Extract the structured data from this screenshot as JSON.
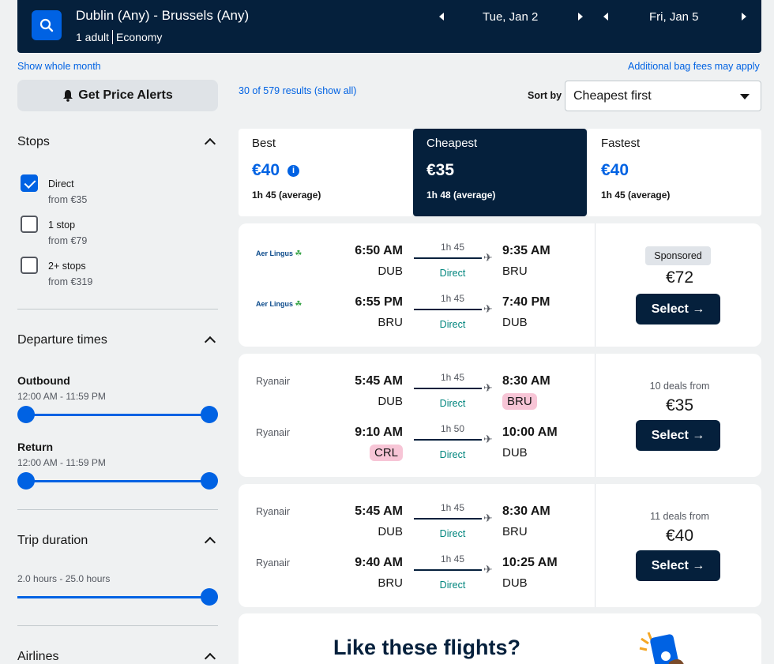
{
  "header": {
    "route": "Dublin (Any) - Brussels (Any)",
    "adults": "1 adult",
    "cabin": "Economy",
    "depart_date": "Tue, Jan 2",
    "return_date": "Fri, Jan 5"
  },
  "links": {
    "show_whole_month": "Show whole month",
    "bag_fees": "Additional bag fees may apply",
    "results": "30 of 579 results (show all)"
  },
  "alerts": {
    "label": "Get Price Alerts"
  },
  "sort": {
    "label": "Sort by",
    "value": "Cheapest first"
  },
  "filters": {
    "stops": {
      "title": "Stops",
      "options": [
        {
          "label": "Direct",
          "from": "from €35",
          "checked": true
        },
        {
          "label": "1 stop",
          "from": "from €79",
          "checked": false
        },
        {
          "label": "2+ stops",
          "from": "from €319",
          "checked": false
        }
      ]
    },
    "departure": {
      "title": "Departure times",
      "outbound_label": "Outbound",
      "outbound_range": "12:00 AM - 11:59 PM",
      "return_label": "Return",
      "return_range": "12:00 AM - 11:59 PM"
    },
    "duration": {
      "title": "Trip duration",
      "range": "2.0 hours - 25.0 hours"
    },
    "airlines": {
      "title": "Airlines"
    }
  },
  "tabs": [
    {
      "label": "Best",
      "price": "€40",
      "avg": "1h 45 (average)"
    },
    {
      "label": "Cheapest",
      "price": "€35",
      "avg": "1h 48 (average)"
    },
    {
      "label": "Fastest",
      "price": "€40",
      "avg": "1h 45 (average)"
    }
  ],
  "cards": [
    {
      "sponsored": "Sponsored",
      "price": "€72",
      "select": "Select →",
      "legs": [
        {
          "airline": "Aer Lingus",
          "dep": "6:50 AM",
          "dep_code": "DUB",
          "dur": "1h 45",
          "stops": "Direct",
          "arr": "9:35 AM",
          "arr_code": "BRU"
        },
        {
          "airline": "Aer Lingus",
          "dep": "6:55 PM",
          "dep_code": "BRU",
          "dur": "1h 45",
          "stops": "Direct",
          "arr": "7:40 PM",
          "arr_code": "DUB"
        }
      ]
    },
    {
      "deals": "10 deals from",
      "price": "€35",
      "select": "Select →",
      "legs": [
        {
          "airline": "Ryanair",
          "dep": "5:45 AM",
          "dep_code": "DUB",
          "dur": "1h 45",
          "stops": "Direct",
          "arr": "8:30 AM",
          "arr_code": "BRU"
        },
        {
          "airline": "Ryanair",
          "dep": "9:10 AM",
          "dep_code": "CRL",
          "dur": "1h 50",
          "stops": "Direct",
          "arr": "10:00 AM",
          "arr_code": "DUB"
        }
      ]
    },
    {
      "deals": "11 deals from",
      "price": "€40",
      "select": "Select →",
      "legs": [
        {
          "airline": "Ryanair",
          "dep": "5:45 AM",
          "dep_code": "DUB",
          "dur": "1h 45",
          "stops": "Direct",
          "arr": "8:30 AM",
          "arr_code": "BRU"
        },
        {
          "airline": "Ryanair",
          "dep": "9:40 AM",
          "dep_code": "BRU",
          "dur": "1h 45",
          "stops": "Direct",
          "arr": "10:25 AM",
          "arr_code": "DUB"
        }
      ]
    }
  ],
  "promo": {
    "title": "Like these flights?"
  },
  "colors": {
    "navy": "#05203c",
    "blue": "#0062e3",
    "highlight": "#f7c5d6",
    "green": "#00857d"
  }
}
